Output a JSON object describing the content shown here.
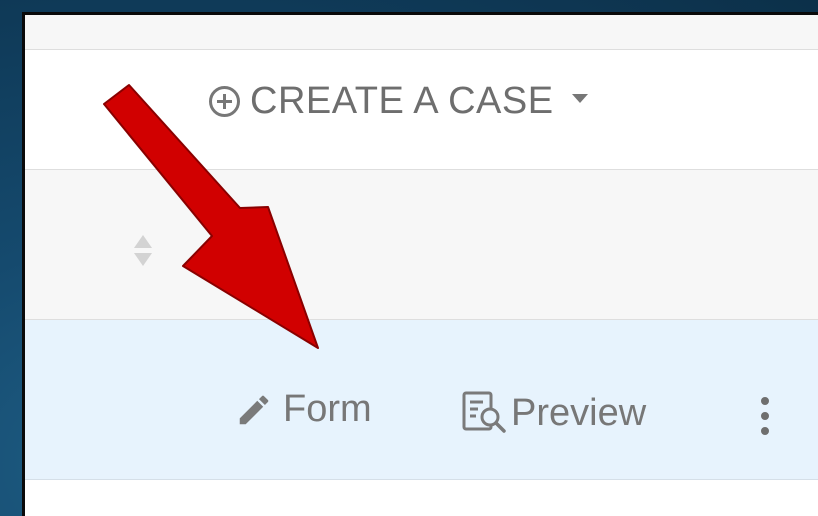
{
  "toolbar": {
    "create_label": "CREATE A CASE",
    "create_icon": "plus-circle-icon",
    "dropdown_icon": "caret-down-icon"
  },
  "table": {
    "sort_icon": "sort-icon"
  },
  "row_actions": {
    "form_label": "Form",
    "form_icon": "pencil-icon",
    "preview_label": "Preview",
    "preview_icon": "document-search-icon",
    "more_icon": "vertical-ellipsis-icon"
  },
  "annotation": {
    "arrow_icon": "red-arrow-icon",
    "arrow_color": "#d10000"
  },
  "colors": {
    "background": "#154a6e",
    "selected_row": "#e7f3fd",
    "icon_gray": "#777777"
  }
}
